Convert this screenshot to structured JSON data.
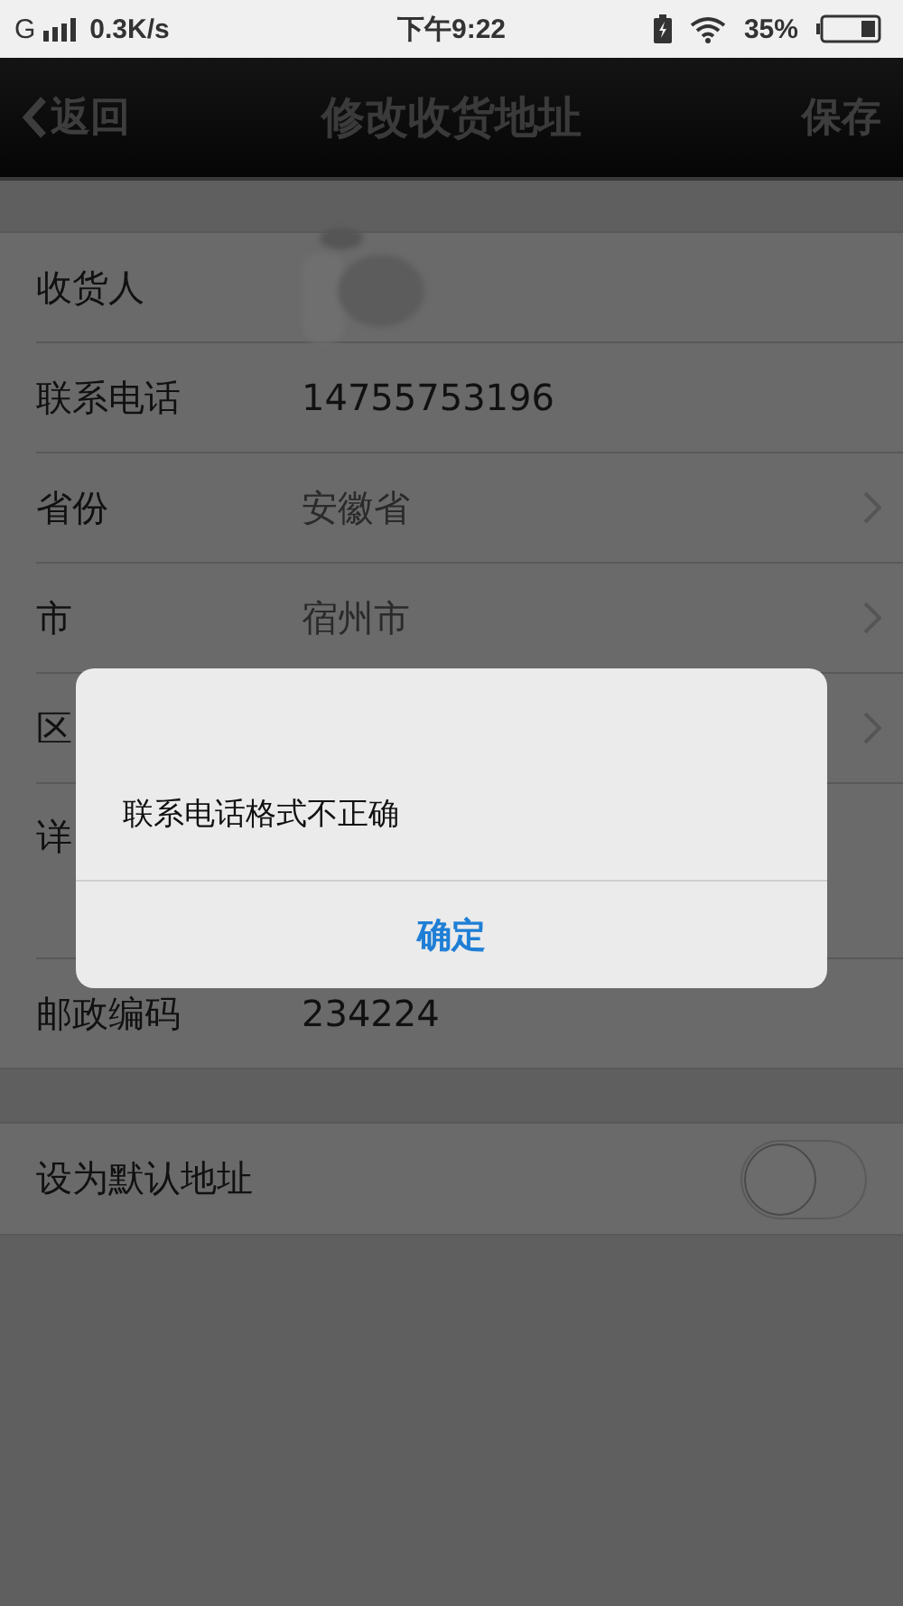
{
  "status_bar": {
    "network": "G",
    "speed": "0.3K/s",
    "time": "下午9:22",
    "battery": "35%"
  },
  "nav_bar": {
    "back": "返回",
    "title": "修改收货地址",
    "action": "保存"
  },
  "form": {
    "rows": [
      {
        "label": "收货人",
        "kind": "redacted"
      },
      {
        "label": "联系电话",
        "value": "14755753196",
        "kind": "text"
      },
      {
        "label": "省份",
        "value": "安徽省",
        "kind": "select"
      },
      {
        "label": "市",
        "value": "宿州市",
        "kind": "select"
      },
      {
        "label": "区",
        "kind": "select"
      },
      {
        "label": "详",
        "kind": "tall"
      },
      {
        "label": "邮政编码",
        "value": "234224",
        "kind": "text"
      }
    ]
  },
  "default_address": {
    "label": "设为默认地址",
    "on": false
  },
  "dialog": {
    "message": "联系电话格式不正确",
    "button": "确定"
  }
}
